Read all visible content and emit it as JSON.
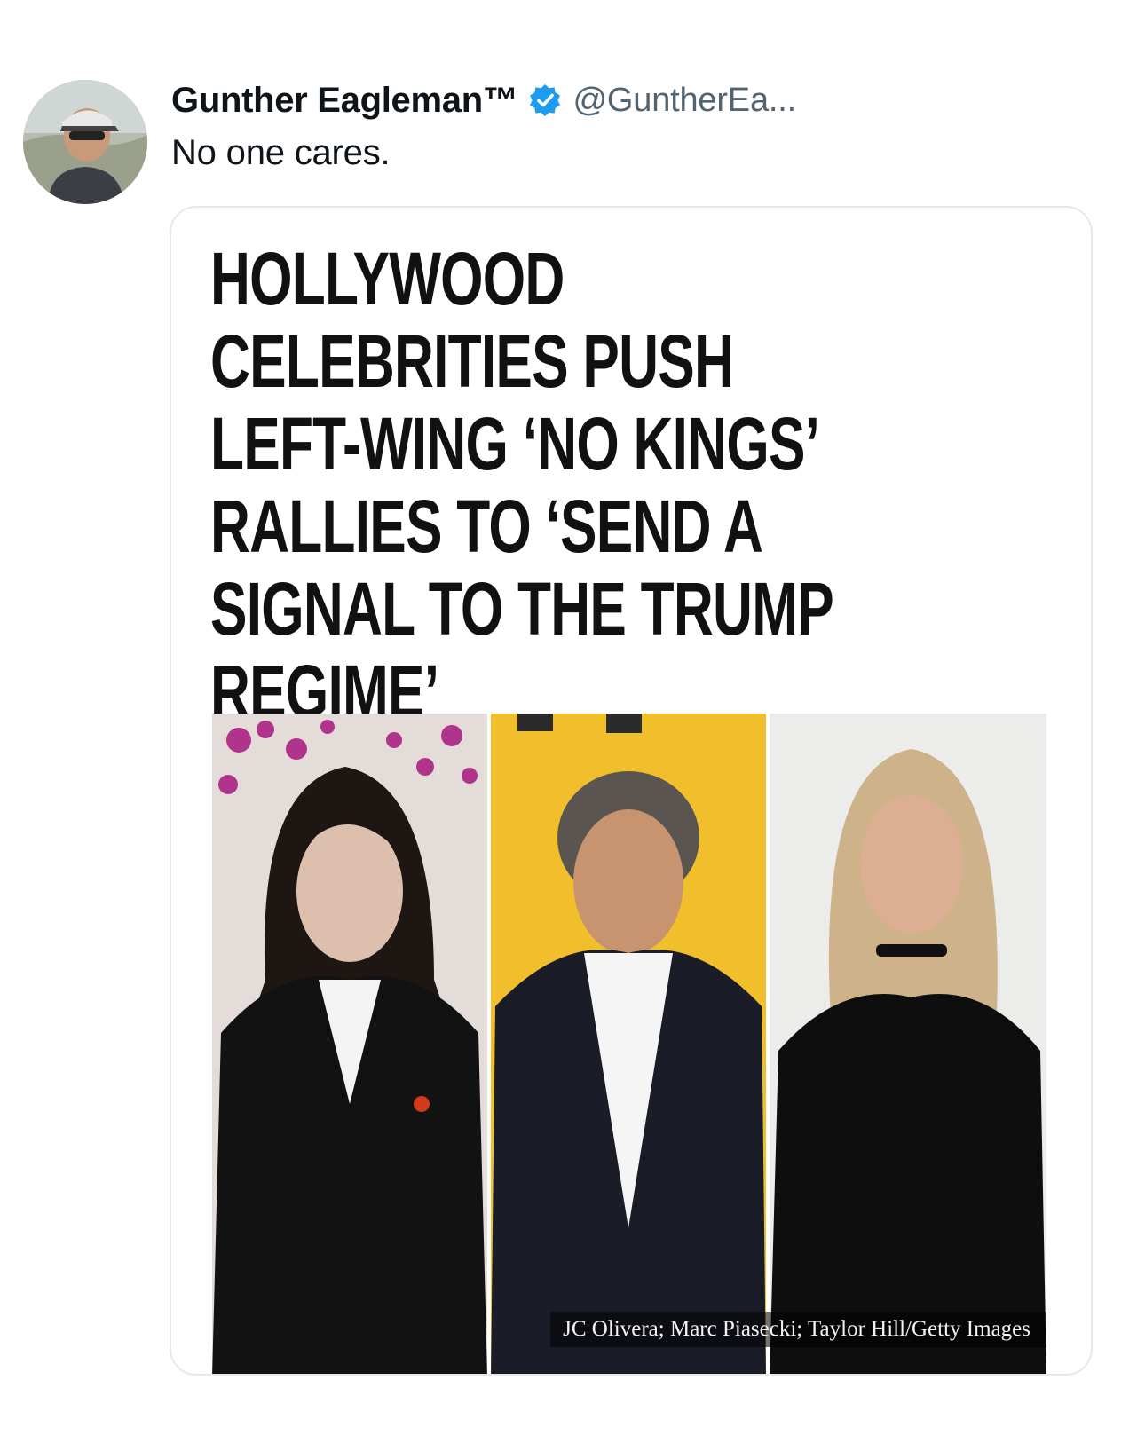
{
  "tweet": {
    "author": {
      "display_name": "Gunther Eagleman™",
      "handle": "@GuntherEa...",
      "verified": true,
      "avatar_icon": "profile-photo"
    },
    "text": "No one cares.",
    "media": {
      "headline": "HOLLYWOOD CELEBRITIES PUSH LEFT-WING ‘NO KINGS’ RALLIES TO ‘SEND A SIGNAL TO THE TRUMP REGIME’",
      "photo_credit": "JC Olivera; Marc Piasecki; Taylor Hill/Getty Images",
      "photos": [
        {
          "icon": "person-photo-1"
        },
        {
          "icon": "person-photo-2"
        },
        {
          "icon": "person-photo-3"
        }
      ]
    }
  },
  "colors": {
    "verified_blue": "#1d9bf0",
    "handle_gray": "#536471",
    "card_border": "#e6e9ec"
  }
}
